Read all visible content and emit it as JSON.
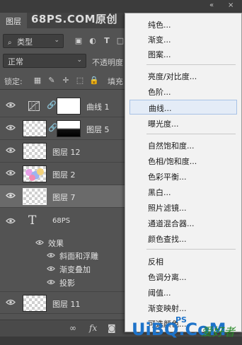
{
  "window": {
    "collapse_icon": "«",
    "close_icon": "×"
  },
  "tabs": {
    "layers": "图层"
  },
  "watermark": "68PS.COM原创",
  "filter": {
    "kind_value": "类型"
  },
  "blend": {
    "mode_value": "正常",
    "opacity_label": "不透明度"
  },
  "lock": {
    "label": "锁定:",
    "fill_label": "填充"
  },
  "layers": [
    {
      "name": "曲线 1",
      "kind": "adjustment"
    },
    {
      "name": "图层 5",
      "kind": "masked"
    },
    {
      "name": "图层 12",
      "kind": "pixel"
    },
    {
      "name": "图层 2",
      "kind": "pixel"
    },
    {
      "name": "图层 7",
      "kind": "pixel",
      "selected": true
    },
    {
      "name": "68PS",
      "kind": "text"
    }
  ],
  "effects": {
    "header": "效果",
    "items": [
      "斜面和浮雕",
      "渐变叠加",
      "投影"
    ]
  },
  "last_layer": {
    "name": "图层 11"
  },
  "bottom": {
    "link_icon": "link-icon",
    "fx": "fx"
  },
  "menu": {
    "items": [
      "纯色...",
      "渐变...",
      "图案...",
      "亮度/对比度...",
      "色阶...",
      "曲线...",
      "曝光度...",
      "自然饱和度...",
      "色相/饱和度...",
      "色彩平衡...",
      "黑白...",
      "照片滤镜...",
      "通道混合器...",
      "颜色查找...",
      "反相",
      "色调分离...",
      "阈值...",
      "渐变映射...",
      "可选颜色..."
    ],
    "highlighted": "曲线..."
  },
  "brand": {
    "logo": "UiBQ.CoM",
    "ps": "PS",
    "cn": "爱好者"
  }
}
